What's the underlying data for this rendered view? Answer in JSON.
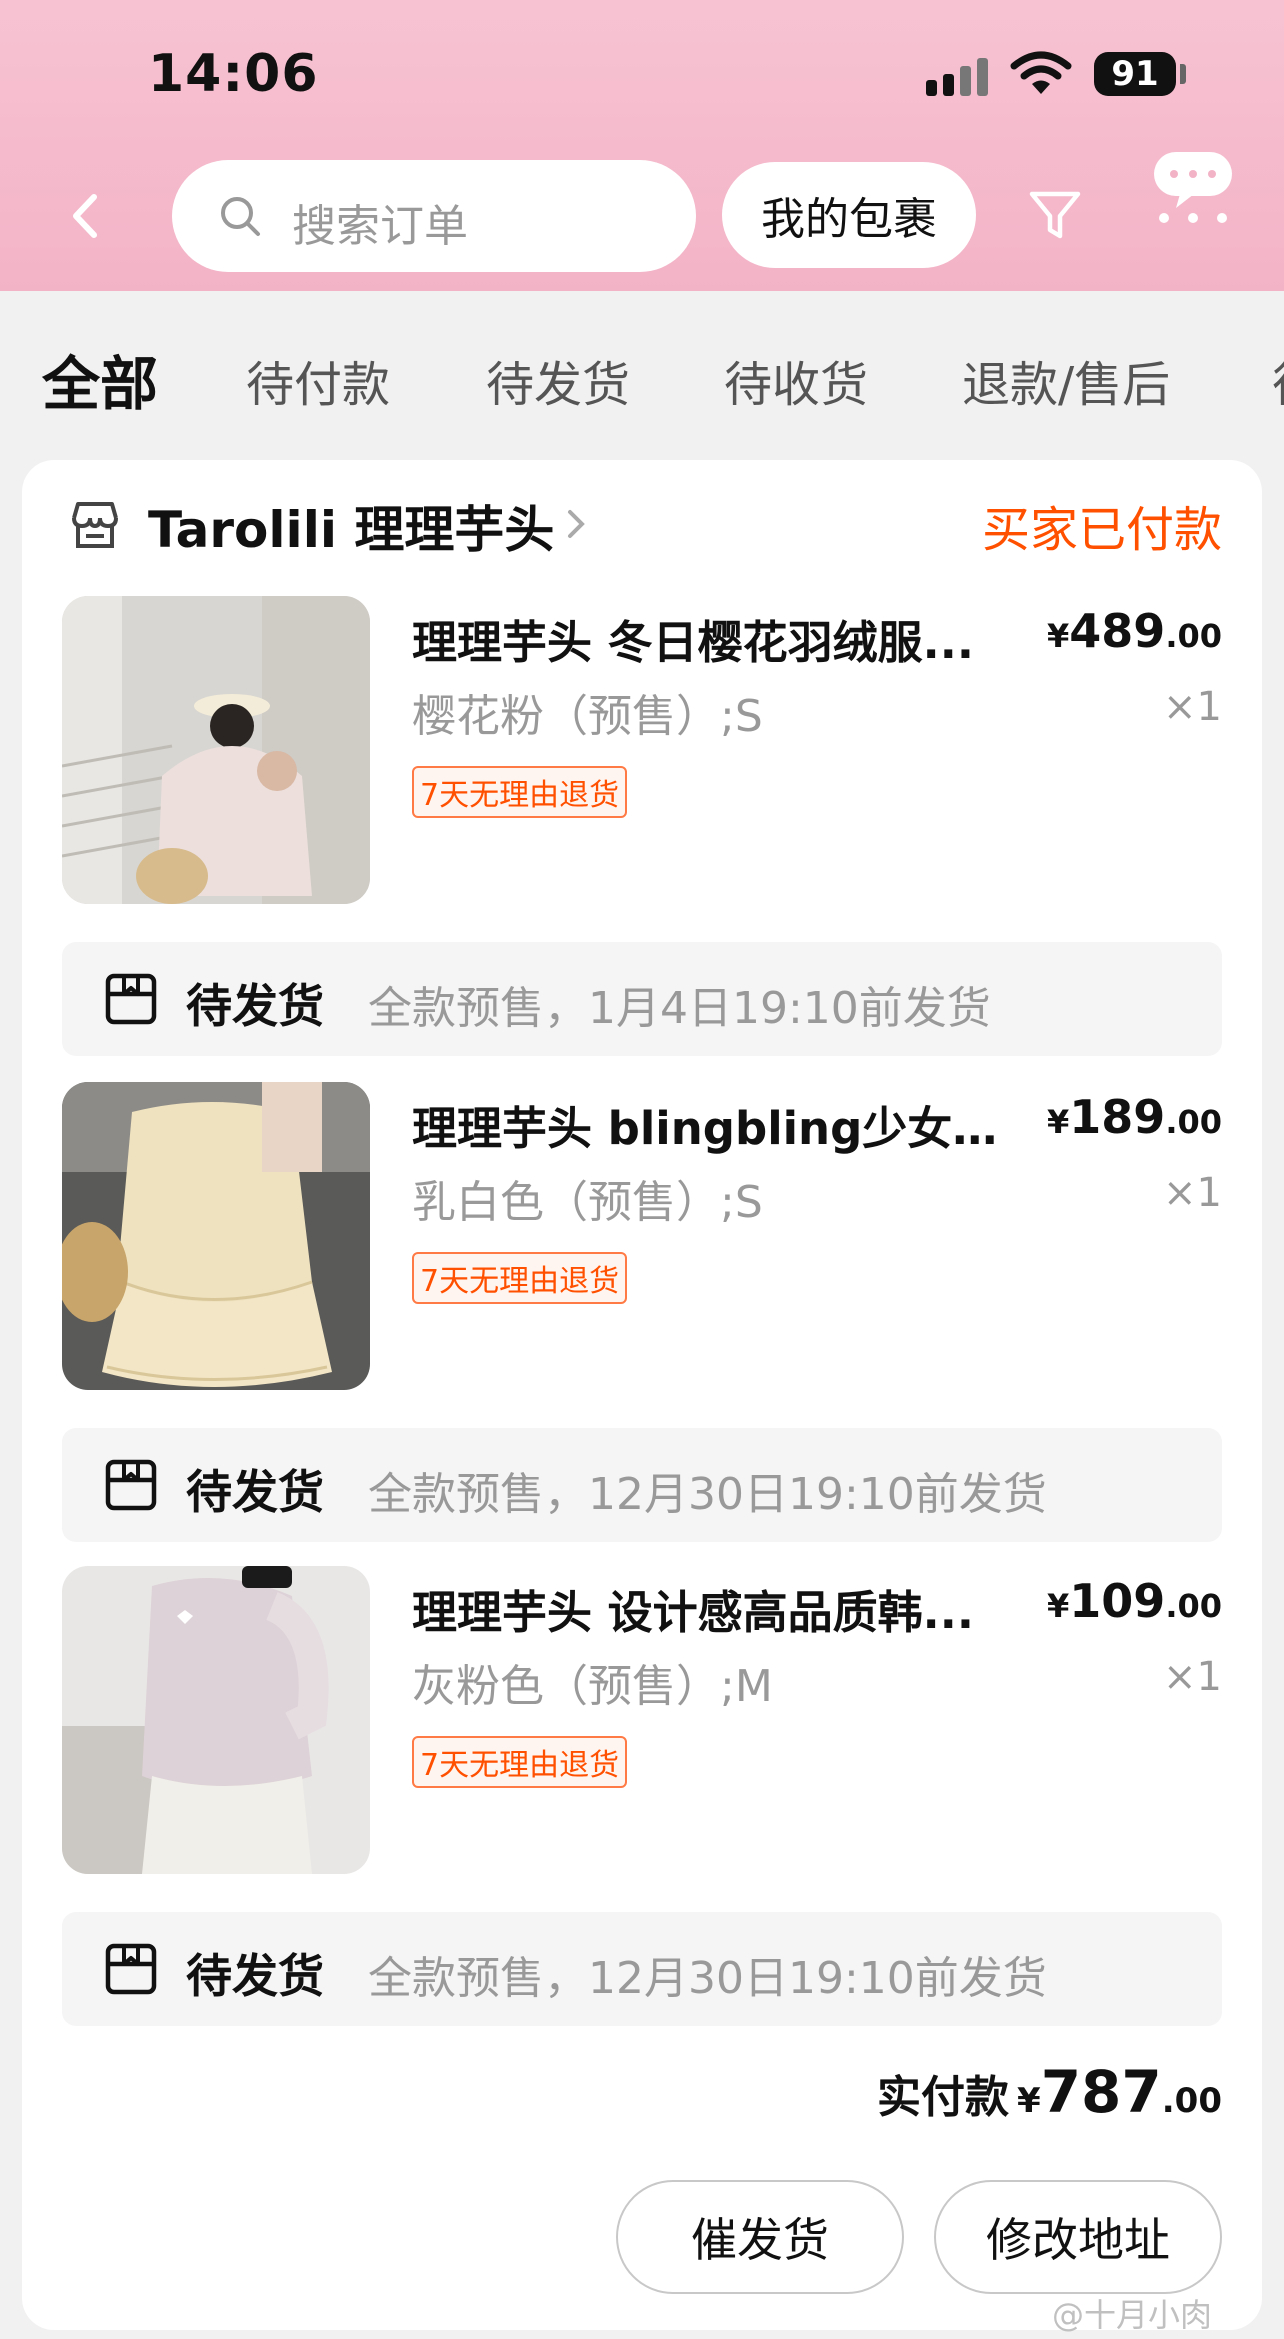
{
  "status_bar": {
    "time": "14:06",
    "battery": "91"
  },
  "header": {
    "search_placeholder": "搜索订单",
    "package_button": "我的包裹"
  },
  "tabs": [
    {
      "label": "全部",
      "active": true
    },
    {
      "label": "待付款",
      "active": false
    },
    {
      "label": "待发货",
      "active": false
    },
    {
      "label": "待收货",
      "active": false
    },
    {
      "label": "退款/售后",
      "active": false
    }
  ],
  "order": {
    "shop_name": "Tarolili 理理芋头",
    "status": "买家已付款",
    "items": [
      {
        "title": "理理芋头 冬日樱花羽绒服...",
        "price_yen": "¥",
        "price_int": "489",
        "price_dec": ".00",
        "sku": "樱花粉（预售）;S",
        "qty": "×1",
        "badge": "7天无理由退货",
        "ship_status": "待发货",
        "ship_desc": "全款预售，1月4日19:10前发货"
      },
      {
        "title": "理理芋头 blingbling少女精...",
        "price_yen": "¥",
        "price_int": "189",
        "price_dec": ".00",
        "sku": "乳白色（预售）;S",
        "qty": "×1",
        "badge": "7天无理由退货",
        "ship_status": "待发货",
        "ship_desc": "全款预售，12月30日19:10前发货"
      },
      {
        "title": "理理芋头 设计感高品质韩...",
        "price_yen": "¥",
        "price_int": "109",
        "price_dec": ".00",
        "sku": "灰粉色（预售）;M",
        "qty": "×1",
        "badge": "7天无理由退货",
        "ship_status": "待发货",
        "ship_desc": "全款预售，12月30日19:10前发货"
      }
    ],
    "total_label": "实付款",
    "total_yen": "¥",
    "total_int": "787",
    "total_dec": ".00",
    "actions": [
      "催发货",
      "修改地址"
    ]
  },
  "watermark": "@十月小肉",
  "colors": {
    "accent": "#ff5000",
    "header_pink": "#f7c3d2"
  }
}
